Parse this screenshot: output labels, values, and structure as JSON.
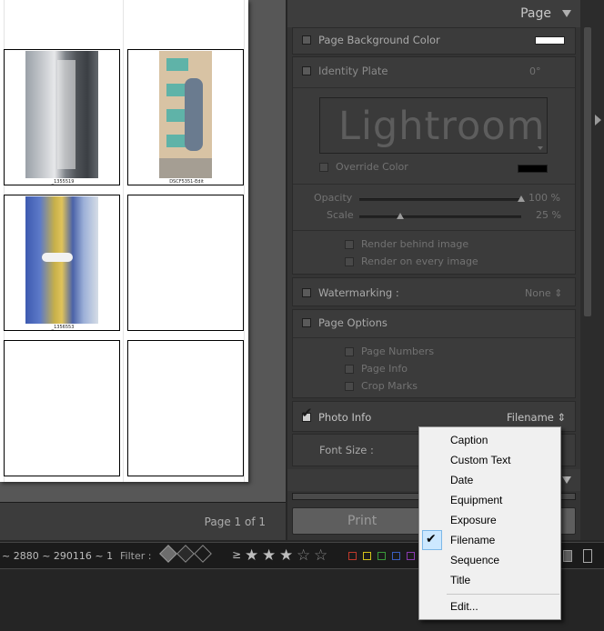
{
  "canvas": {
    "captions": [
      "_1355519",
      "DSCF5351-Edit",
      "_1356553"
    ],
    "page_count": "Page 1 of 1"
  },
  "panel": {
    "header_title": "Page",
    "page_background_color": "Page Background Color",
    "identity_plate": "Identity Plate",
    "identity_rotation": "0°",
    "lightroom_text": "Lightroom",
    "override_color": "Override Color",
    "opacity_label": "Opacity",
    "opacity_value": "100 %",
    "opacity_level": 1.0,
    "scale_label": "Scale",
    "scale_value": "25 %",
    "scale_level": 0.25,
    "render_behind": "Render behind image",
    "render_every": "Render on every image",
    "watermarking_label": "Watermarking :",
    "watermarking_value": "None ⇕",
    "page_options": "Page Options",
    "page_numbers": "Page Numbers",
    "page_info": "Page Info",
    "crop_marks": "Crop Marks",
    "photo_info": "Photo Info",
    "photo_info_value": "Filename ⇕",
    "font_size": "Font Size :",
    "print_button": "Print"
  },
  "filterbar": {
    "path_text": "~ 2880 ~ 290116 ~ 1",
    "filter_label": "Filter :",
    "gte": "≥",
    "stars": [
      "★",
      "★",
      "★",
      "☆",
      "☆"
    ],
    "color_labels": [
      "#c0392b",
      "#d4c21a",
      "#3a9a3a",
      "#3a5ec0",
      "#8a3ab0"
    ]
  },
  "menu": {
    "items": [
      "Caption",
      "Custom Text",
      "Date",
      "Equipment",
      "Exposure",
      "Filename",
      "Sequence",
      "Title"
    ],
    "checked": "Filename",
    "edit": "Edit..."
  },
  "colors": {
    "panel_bg": "#343434",
    "menu_bg": "#f0f0f0",
    "menu_highlight": "#cce8ff"
  }
}
